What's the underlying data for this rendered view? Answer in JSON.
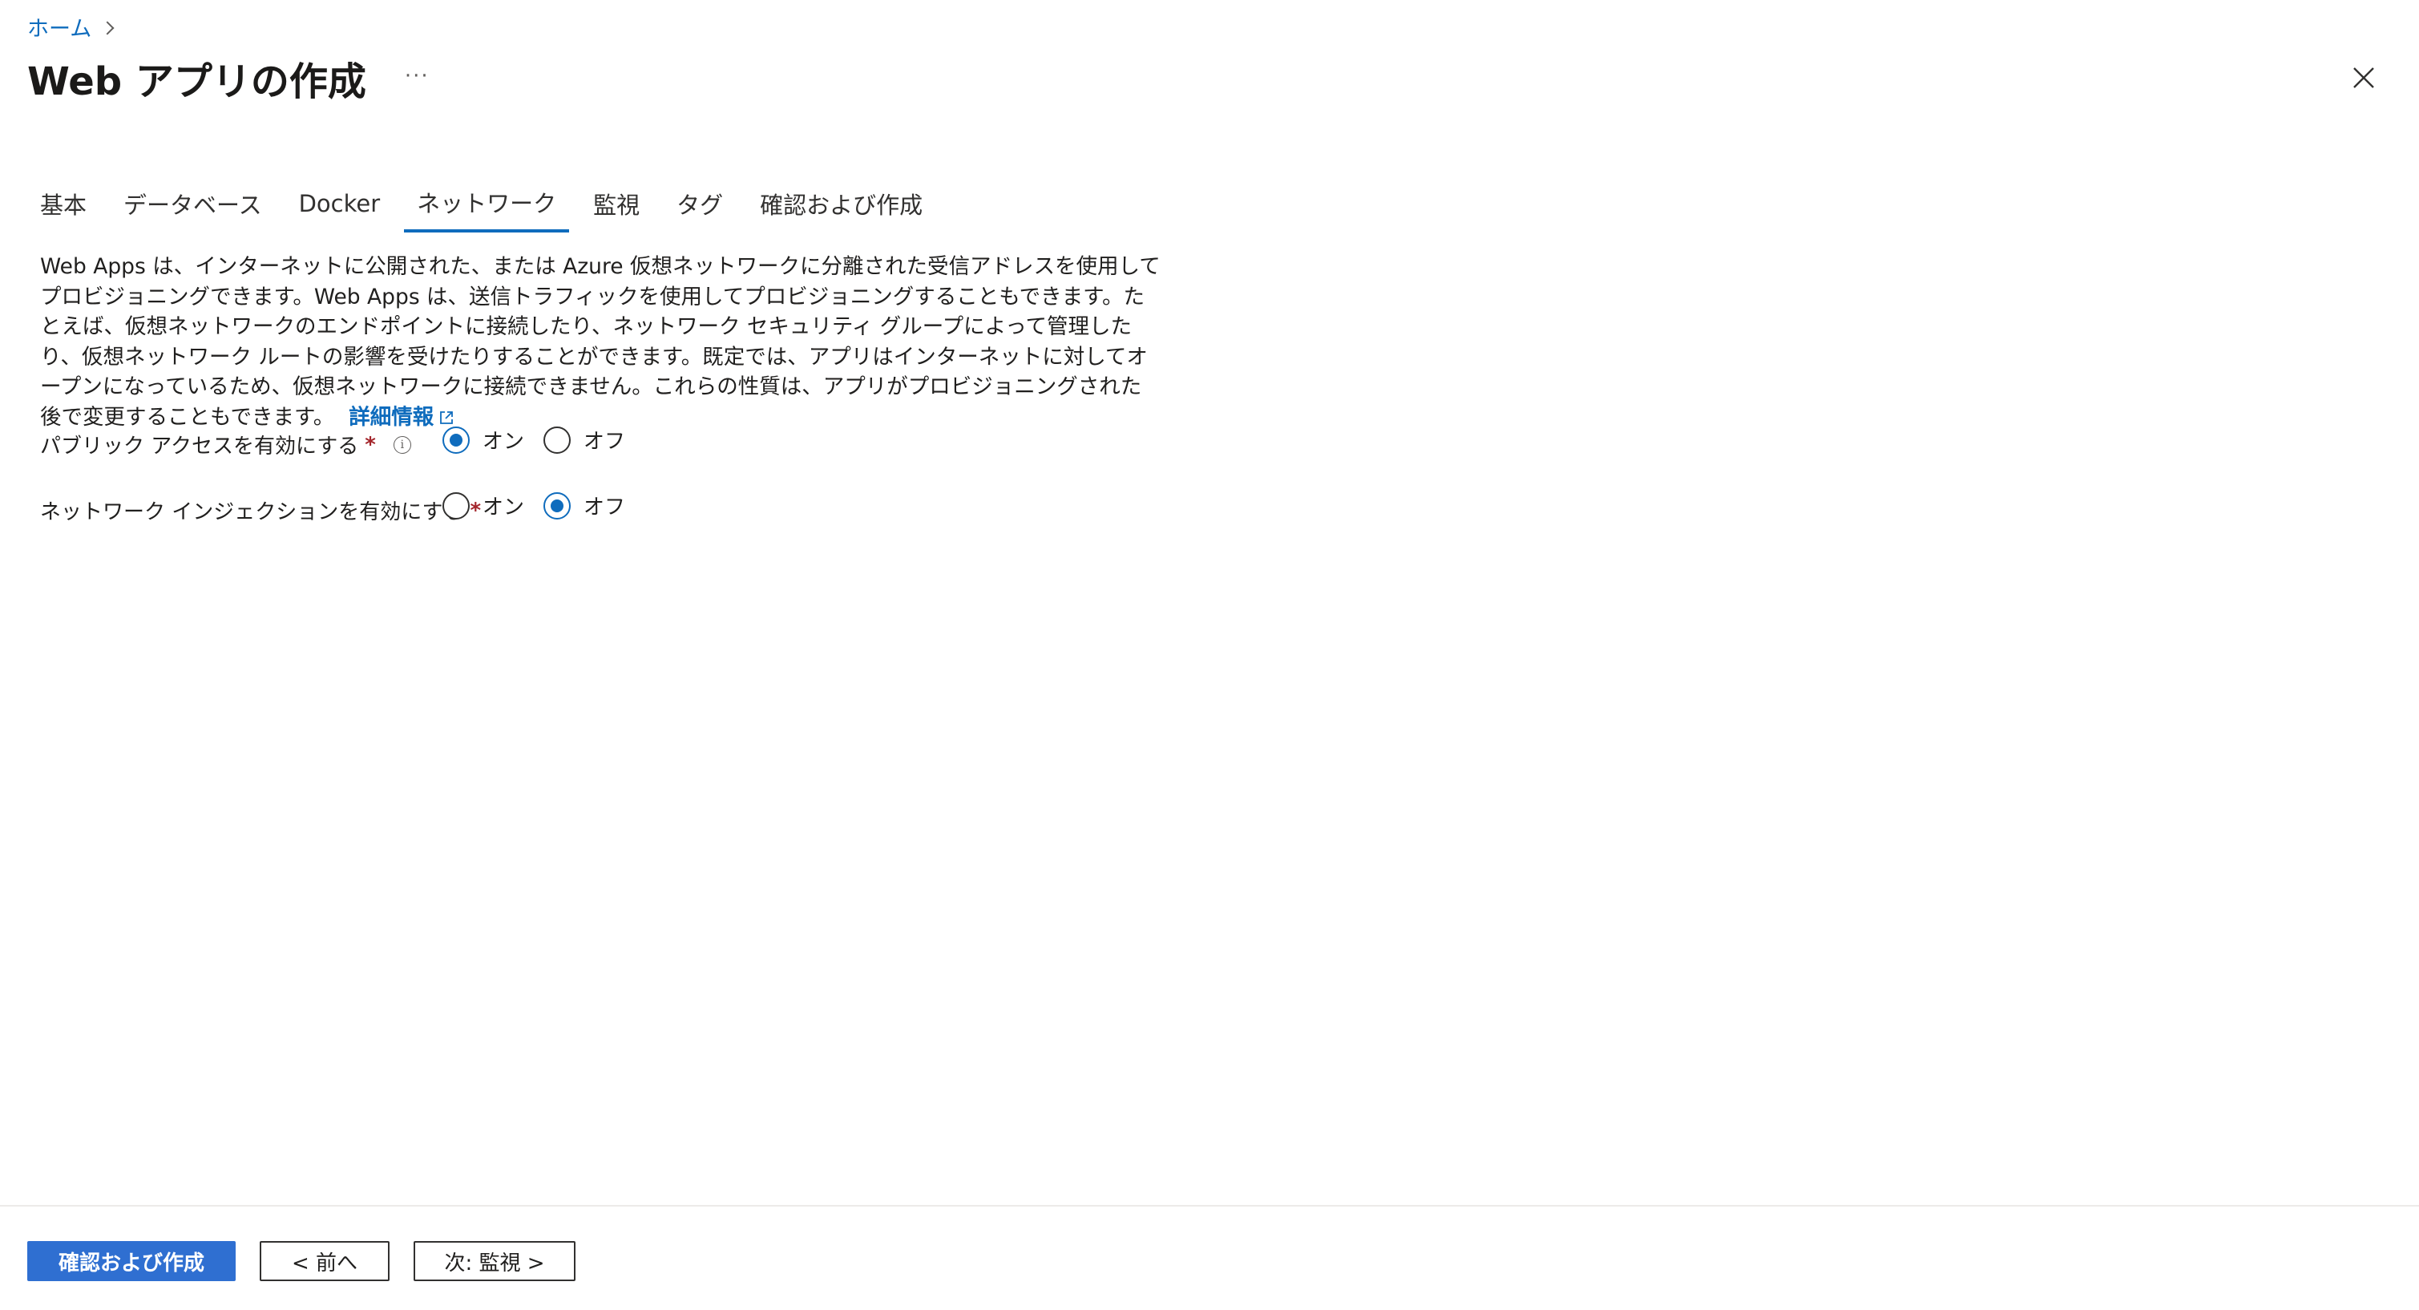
{
  "breadcrumb": {
    "home": "ホーム"
  },
  "header": {
    "title": "Web アプリの作成",
    "more": "···"
  },
  "tabs": [
    {
      "label": "基本",
      "active": false
    },
    {
      "label": "データベース",
      "active": false
    },
    {
      "label": "Docker",
      "active": false
    },
    {
      "label": "ネットワーク",
      "active": true
    },
    {
      "label": "監視",
      "active": false
    },
    {
      "label": "タグ",
      "active": false
    },
    {
      "label": "確認および作成",
      "active": false
    }
  ],
  "description": {
    "text": "Web Apps は、インターネットに公開された、または Azure 仮想ネットワークに分離された受信アドレスを使用してプロビジョニングできます。Web Apps は、送信トラフィックを使用してプロビジョニングすることもできます。たとえば、仮想ネットワークのエンドポイントに接続したり、ネットワーク セキュリティ グループによって管理したり、仮想ネットワーク ルートの影響を受けたりすることができます。既定では、アプリはインターネットに対してオープンになっているため、仮想ネットワークに接続できません。これらの性質は、アプリがプロビジョニングされた後で変更することもできます。",
    "link": "詳細情報"
  },
  "fields": {
    "public_access": {
      "label": "パブリック アクセスを有効にする",
      "required": "*",
      "info": "i",
      "options": [
        {
          "label": "オン",
          "checked": true
        },
        {
          "label": "オフ",
          "checked": false
        }
      ]
    },
    "network_injection": {
      "label": "ネットワーク インジェクションを有効にする",
      "required": "*",
      "options": [
        {
          "label": "オン",
          "checked": false
        },
        {
          "label": "オフ",
          "checked": true
        }
      ]
    }
  },
  "footer": {
    "review_create": "確認および作成",
    "previous": "< 前へ",
    "next": "次: 監視 >"
  },
  "colors": {
    "accent": "#0f6cbd",
    "primary_button": "#2f6fd1",
    "required": "#a4262c"
  },
  "icons": {
    "close": "close-icon",
    "breadcrumb_separator": "chevron-right-icon",
    "external_link": "external-link-icon",
    "info": "info-icon"
  }
}
